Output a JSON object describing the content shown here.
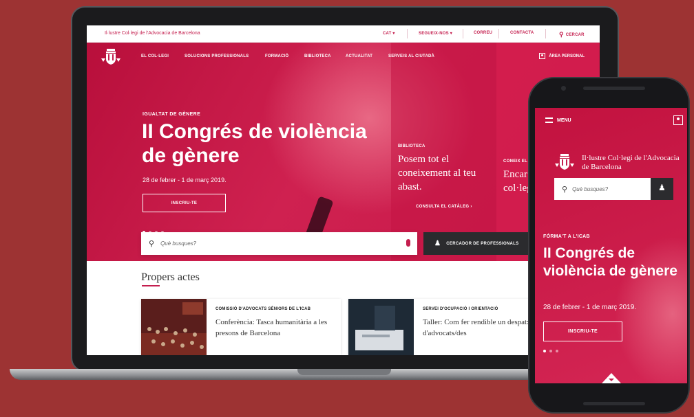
{
  "colors": {
    "background": "#9d3333",
    "brand": "#c41e4e",
    "dark": "#2b2b2e"
  },
  "topbar": {
    "institution": "Il·lustre Col·legi de l'Advocacia de Barcelona",
    "lang": "CAT ▾",
    "follow": "SEGUEIX-NOS ▾",
    "mail": "CORREU",
    "contact": "CONTACTA",
    "search": "CERCAR"
  },
  "nav": {
    "items": [
      "EL COL·LEGI",
      "SOLUCIONS PROFESSIONALS",
      "FORMACIÓ",
      "BIBLIOTECA",
      "ACTUALITAT",
      "SERVEIS AL CIUTADÀ"
    ],
    "personal_area": "ÀREA PERSONAL"
  },
  "hero": {
    "eyebrow": "IGUALTAT DE GÈNERE",
    "title": "II Congrés de violència de gènere",
    "date": "28 de febrer - 1 de març 2019.",
    "button": "INSCRIU-TE"
  },
  "side": {
    "lib_label": "BIBLIOTECA",
    "lib_text": "Posem tot el coneixement al teu abast.",
    "lib_link": "CONSULTA EL CATÀLEG ›",
    "know_label": "CONEIX EL",
    "know_text": "Encar col·leg"
  },
  "search": {
    "placeholder": "Què busques?",
    "professional_finder": "CERCADOR DE PROFESSIONALS"
  },
  "events": {
    "heading": "Propers actes",
    "cards": [
      {
        "category": "COMISSIÓ D'ADVOCATS SÈNIORS DE L'ICAB",
        "title": "Conferència: Tasca humanitària a les presons de Barcelona"
      },
      {
        "category": "SERVEI D'OCUPACIÓ I ORIENTACIÓ",
        "title": "Taller: Com fer rendible un despatx d'advocats/des"
      }
    ]
  },
  "mobile": {
    "menu": "MENU",
    "institution": "Il·lustre Col·legi de l'Advocacia de Barcelona",
    "placeholder": "Què busques?",
    "eyebrow": "FÓRMA'T A L'ICAB",
    "title": "II Congrés de violència de gènere",
    "date": "28 de febrer - 1 de març 2019.",
    "button": "INSCRIU-TE"
  }
}
